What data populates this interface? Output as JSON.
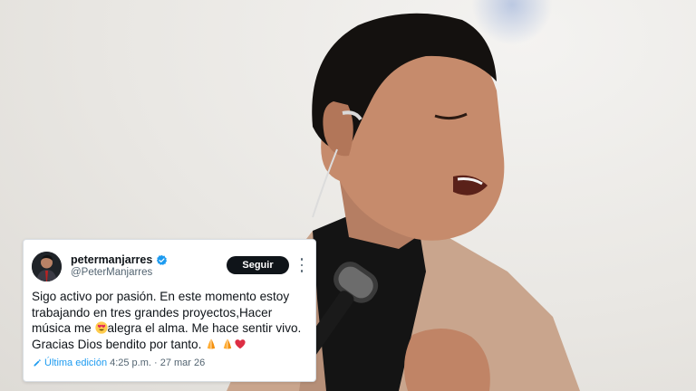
{
  "tweet": {
    "display_name": "petermanjarres",
    "handle": "@PeterManjarres",
    "follow_label": "Seguir",
    "text_lines": [
      "Sigo activo por pasión.  En este momento estoy",
      "trabajando en tres grandes proyectos,Hacer",
      "música me",
      "alegra el alma. Me hace sentir vivo.",
      "Gracias Dios bendito por tanto."
    ],
    "emojis": [
      "heart-eyes-icon",
      "folded-hands-icon",
      "folded-hands-icon",
      "red-heart-icon"
    ],
    "edited_label": "Última edición",
    "timestamp": "4:25 p.m. · 27 mar 26",
    "colors": {
      "verified": "#1d9bf0",
      "follow_bg": "#0f1419",
      "link": "#1d9bf0"
    }
  }
}
